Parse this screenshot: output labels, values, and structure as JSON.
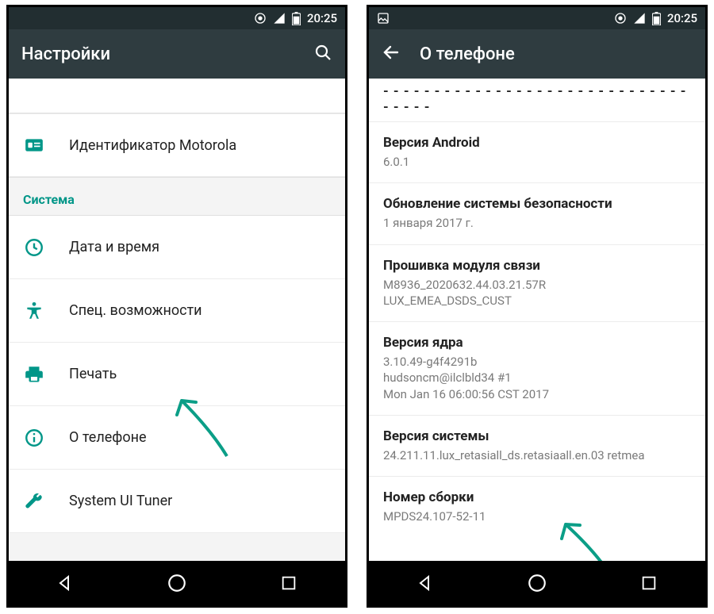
{
  "status": {
    "time": "20:25"
  },
  "left": {
    "title": "Настройки",
    "topItem": {
      "label": "Идентификатор Motorola"
    },
    "sectionHeader": "Система",
    "items": [
      {
        "label": "Дата и время"
      },
      {
        "label": "Спец. возможности"
      },
      {
        "label": "Печать"
      },
      {
        "label": "О телефоне"
      },
      {
        "label": "System UI Tuner"
      }
    ]
  },
  "right": {
    "title": "О телефоне",
    "cutoff": "- - - - - - - - - - - - - - - - - - - - - - - - - - - - - - - - - - -",
    "blocks": [
      {
        "title": "Версия Android",
        "value": "6.0.1"
      },
      {
        "title": "Обновление системы безопасности",
        "value": "1 января 2017 г."
      },
      {
        "title": "Прошивка модуля связи",
        "value": "M8936_2020632.44.03.21.57R\nLUX_EMEA_DSDS_CUST"
      },
      {
        "title": "Версия ядра",
        "value": "3.10.49-g4f4291b\nhudsoncm@ilclbld34 #1\nMon Jan 16 06:00:56 CST 2017"
      },
      {
        "title": "Версия системы",
        "value": "24.211.11.lux_retasiall_ds.retasiaall.en.03 retmea"
      },
      {
        "title": "Номер сборки",
        "value": "MPDS24.107-52-11"
      }
    ]
  }
}
